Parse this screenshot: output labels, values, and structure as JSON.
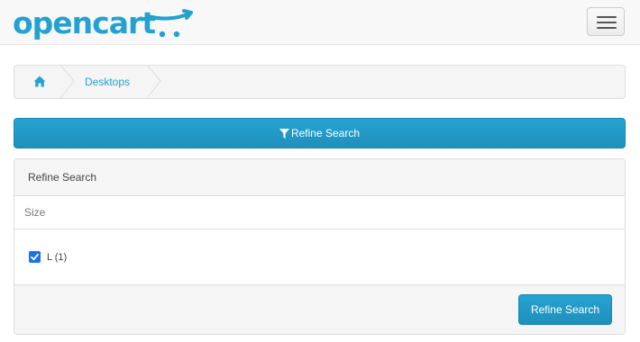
{
  "header": {
    "logo_text": "opencart",
    "brand_color": "#23a1d1",
    "menu_icon": "hamburger-icon"
  },
  "breadcrumb": {
    "home_icon": "home-icon",
    "items": [
      {
        "label": "Desktops"
      }
    ]
  },
  "refine_bar": {
    "icon": "filter-icon",
    "label": "Refine Search"
  },
  "filter_panel": {
    "heading": "Refine Search",
    "groups": [
      {
        "title": "Size",
        "options": [
          {
            "label": "L (1)",
            "checked": true
          }
        ]
      }
    ],
    "submit_label": "Refine Search"
  }
}
